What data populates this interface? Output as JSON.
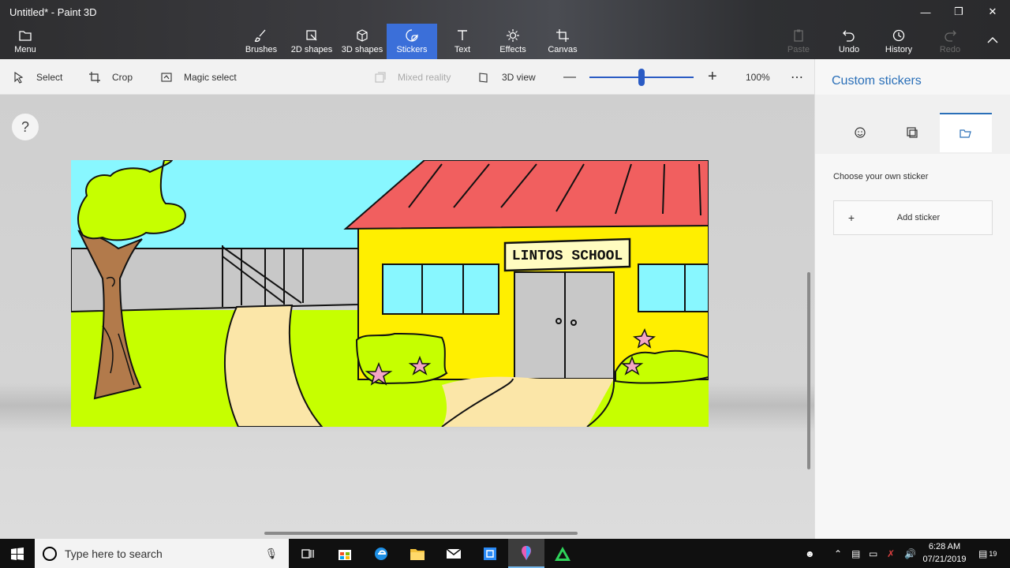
{
  "window": {
    "title": "Untitled* - Paint 3D",
    "controls": [
      "minimize",
      "restore",
      "close"
    ]
  },
  "ribbon": {
    "menu_label": "Menu",
    "items": [
      {
        "label": "Brushes"
      },
      {
        "label": "2D shapes"
      },
      {
        "label": "3D shapes"
      },
      {
        "label": "Stickers",
        "active": true
      },
      {
        "label": "Text"
      },
      {
        "label": "Effects"
      },
      {
        "label": "Canvas"
      }
    ],
    "right": [
      {
        "label": "Paste",
        "disabled": true
      },
      {
        "label": "Undo"
      },
      {
        "label": "History"
      },
      {
        "label": "Redo",
        "disabled": true
      }
    ]
  },
  "toolbar": {
    "select": "Select",
    "crop": "Crop",
    "magic_select": "Magic select",
    "mixed_reality": "Mixed reality",
    "view_3d": "3D view",
    "zoom": "100%",
    "zoom_fraction": 0.5
  },
  "canvas": {
    "sign_text": "LINTOS SCHOOL",
    "help": "?"
  },
  "panel": {
    "title": "Custom stickers",
    "tabs": [
      "sticker-face-icon",
      "sticker-texture-icon",
      "folder-icon"
    ],
    "active_tab": 2,
    "description": "Choose your own sticker",
    "add_label": "Add sticker",
    "add_plus": "+"
  },
  "taskbar": {
    "search_placeholder": "Type here to search",
    "time": "6:28 AM",
    "date": "07/21/2019",
    "notifications": "19"
  },
  "colors": {
    "accent": "#3b6fd9",
    "panel_title": "#2a6fb8",
    "sky": "#88f7ff",
    "grass": "#c6ff00",
    "roof": "#f15f5f",
    "wall": "#ffef00",
    "path": "#fbe6a8",
    "fence": "#c8c8c8",
    "trunk": "#b27a4b"
  }
}
